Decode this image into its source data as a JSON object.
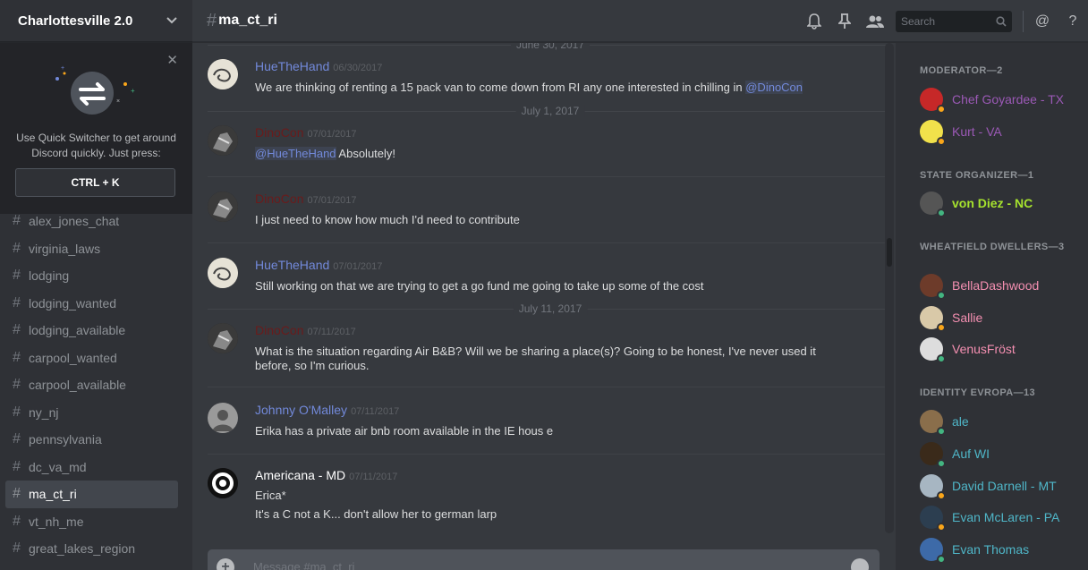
{
  "server": {
    "name": "Charlottesville 2.0"
  },
  "quick_switcher": {
    "text": "Use Quick Switcher to get around Discord quickly. Just press:",
    "shortcut": "CTRL + K"
  },
  "channels": [
    {
      "name": "alex_jones_chat"
    },
    {
      "name": "virginia_laws"
    },
    {
      "name": "lodging"
    },
    {
      "name": "lodging_wanted"
    },
    {
      "name": "lodging_available"
    },
    {
      "name": "carpool_wanted"
    },
    {
      "name": "carpool_available"
    },
    {
      "name": "ny_nj"
    },
    {
      "name": "pennsylvania"
    },
    {
      "name": "dc_va_md"
    },
    {
      "name": "ma_ct_ri",
      "active": true
    },
    {
      "name": "vt_nh_me"
    },
    {
      "name": "great_lakes_region"
    }
  ],
  "header": {
    "hash": "#",
    "channel_name": "ma_ct_ri",
    "search_placeholder": "Search"
  },
  "dates": [
    "June 30, 2017",
    "July 1, 2017",
    "July 11, 2017"
  ],
  "messages": [
    {
      "author": "HueTheHand",
      "color": "#7289da",
      "time": "06/30/2017",
      "mention_pre": "We are thinking of renting a 15 pack van to come down from RI any one interested in chilling in ",
      "mention": "@DinoCon"
    },
    {
      "author": "DinoCon",
      "color": "#6a1b1b",
      "time": "07/01/2017",
      "mention": "@HueTheHand",
      "text_post": " Absolutely!"
    },
    {
      "author": "DinoCon",
      "color": "#6a1b1b",
      "time": "07/01/2017",
      "text": "I just need to know how much I'd need to contribute"
    },
    {
      "author": "HueTheHand",
      "color": "#7289da",
      "time": "07/01/2017",
      "text": "Still working on that we are trying to get a go fund me going to take up some of the cost"
    },
    {
      "author": "DinoCon",
      "color": "#6a1b1b",
      "time": "07/11/2017",
      "text": "What is the situation regarding Air B&B? Will we be sharing a place(s)? Going to be honest, I've never used it before, so I'm curious."
    },
    {
      "author": "Johnny O'Malley",
      "color": "#7289da",
      "time": "07/11/2017",
      "text": "Erika has a private air bnb room available in the IE hous e"
    },
    {
      "author": "Americana - MD",
      "color": "#ffffff",
      "time": "07/11/2017",
      "text": "Erica*",
      "text2": "It's a C not a K... don't allow her to german larp"
    }
  ],
  "composer": {
    "placeholder": "Message #ma_ct_ri"
  },
  "member_groups": [
    {
      "role": "MODERATOR—2",
      "members": [
        {
          "name": "Chef Goyardee - TX",
          "color": "#9b59b6",
          "status": "#faa61a"
        },
        {
          "name": "Kurt - VA",
          "color": "#9b59b6",
          "status": "#faa61a"
        }
      ]
    },
    {
      "role": "STATE ORGANIZER—1",
      "members": [
        {
          "name": "von Diez - NC",
          "color": "#a6e22e",
          "status": "#43b581"
        }
      ]
    },
    {
      "role": "WHEATFIELD DWELLERS—3",
      "members": [
        {
          "name": "BellaDashwood",
          "color": "#f48fb1",
          "status": "#43b581"
        },
        {
          "name": "Sallie",
          "color": "#f48fb1",
          "status": "#faa61a"
        },
        {
          "name": "VenusFröst",
          "color": "#f48fb1",
          "status": "#43b581"
        }
      ]
    },
    {
      "role": "IDENTITY EVROPA—13",
      "members": [
        {
          "name": "ale",
          "color": "#4fb6c8",
          "status": "#43b581"
        },
        {
          "name": "Auf WI",
          "color": "#4fb6c8",
          "status": "#43b581"
        },
        {
          "name": "David Darnell - MT",
          "color": "#4fb6c8",
          "status": "#faa61a"
        },
        {
          "name": "Evan McLaren - PA",
          "color": "#4fb6c8",
          "status": "#faa61a"
        },
        {
          "name": "Evan Thomas",
          "color": "#4fb6c8",
          "status": "#43b581"
        }
      ]
    }
  ],
  "icons": [
    "bell-icon",
    "pin-icon",
    "members-icon",
    "search-icon",
    "mention-icon",
    "help-icon",
    "chevron-down-icon",
    "close-icon",
    "swap-arrows-icon",
    "plus-icon",
    "emoji-icon"
  ]
}
